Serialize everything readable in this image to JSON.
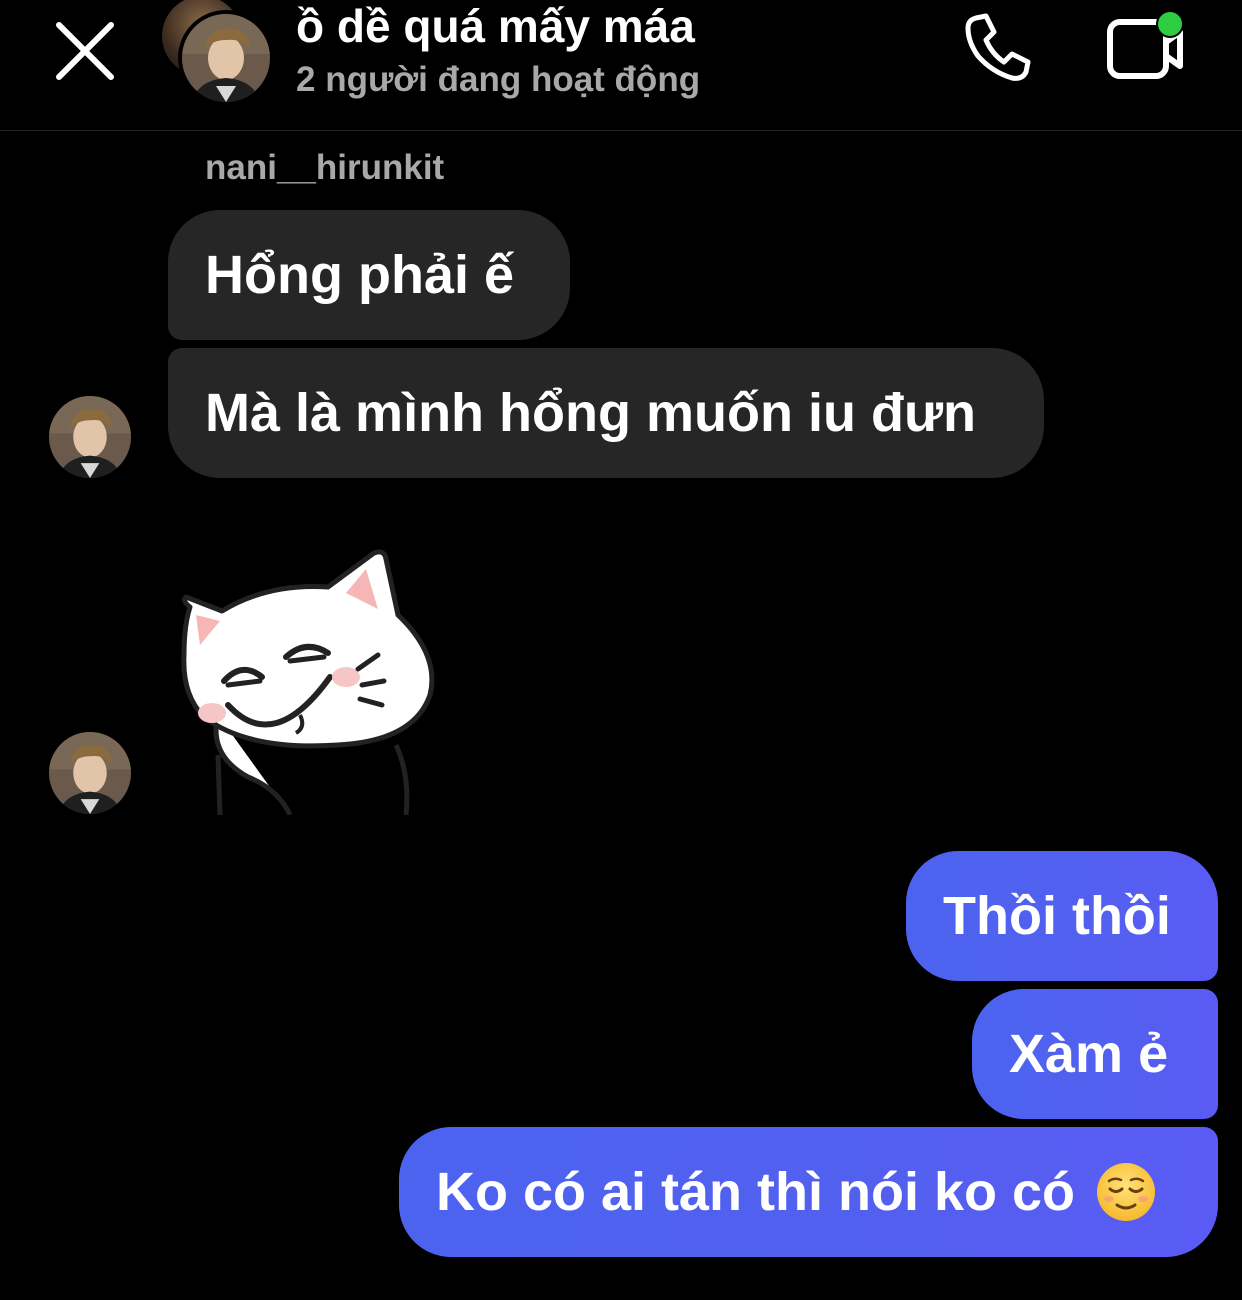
{
  "header": {
    "title": "ồ dề quá mấy máa",
    "status": "2 người đang hoạt động",
    "close_icon": "close-icon",
    "call_icon": "phone-icon",
    "video_icon": "video-call-icon",
    "online_color": "#2ecc40"
  },
  "messages": [
    {
      "sender": "nani__hirunkit",
      "direction": "in",
      "text": "Hổng phải ế"
    },
    {
      "direction": "in",
      "text": "Mà là mình hổng muốn iu đưn"
    },
    {
      "direction": "in",
      "type": "sticker",
      "sticker": "white-cat-smug-sticker"
    },
    {
      "direction": "out",
      "text": "Thồi thồi"
    },
    {
      "direction": "out",
      "text": "Xàm ẻ"
    },
    {
      "direction": "out",
      "text": "Ko có ai tán thì nói ko có",
      "emoji": "relieved-face-emoji"
    }
  ],
  "colors": {
    "background": "#000000",
    "incoming_bubble": "#262626",
    "outgoing_bubble": "#5360ef",
    "secondary_text": "#a8a8a8"
  }
}
